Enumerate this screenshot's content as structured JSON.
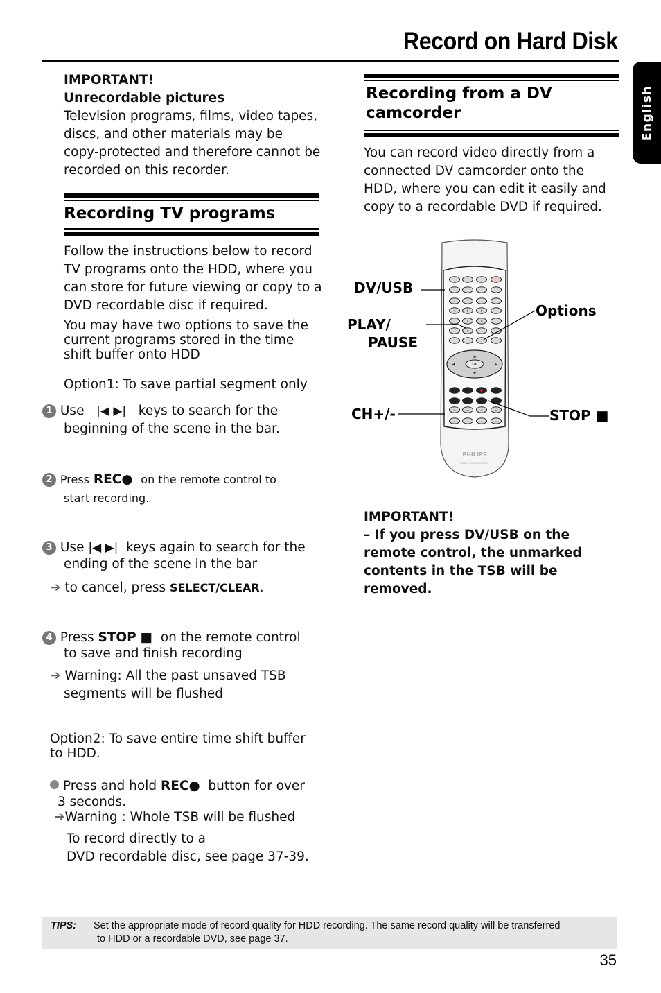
{
  "header": {
    "title": "Record on Hard Disk",
    "language_tab": "English"
  },
  "left_column": {
    "important": {
      "label": "IMPORTANT!",
      "subtitle": "Unrecordable pictures",
      "lines": [
        "Television programs, films, video tapes,",
        "discs, and other materials may be",
        "copy-protected and therefore cannot be",
        "recorded on this recorder."
      ]
    },
    "section_title": "Recording TV programs",
    "intro_lines": [
      "Follow the instructions below to record",
      "TV programs onto the HDD, where you",
      "can store for future viewing or copy to a",
      "DVD recordable disc if required."
    ],
    "options_lines": [
      "You may have two options to save the",
      "current programs stored in the time",
      "shift buffer onto HDD"
    ],
    "option1_heading": "Option1: To save partial segment only",
    "steps": [
      {
        "number": "1",
        "prefix": "Use",
        "icons": "|◀  ▶|",
        "suffix": "keys to search for the",
        "line2": "beginning of the scene in the bar."
      },
      {
        "number": "2",
        "prefix": "Press",
        "bold": "REC",
        "icon": "●",
        "suffix": "on the remote control to",
        "line2": "start recording."
      },
      {
        "number": "3",
        "prefix": "Use",
        "icons": "|◀  ▶|",
        "suffix": "keys again to search for the",
        "line2": "ending of the scene in the bar",
        "note_prefix": "to cancel, press",
        "note_bold": "SELECT/CLEAR",
        "note_suffix": "."
      },
      {
        "number": "4",
        "prefix": "Press",
        "bold": "STOP",
        "icon": "■",
        "suffix": "on the remote control",
        "line2": "to save and finish recording",
        "note_line1": "Warning: All the past unsaved TSB",
        "note_line2": "segments will be flushed"
      }
    ],
    "option2": {
      "line1": "Option2: To save entire time shift buffer",
      "line2": "to HDD.",
      "bullet_prefix": "Press and hold",
      "bullet_bold": "REC",
      "bullet_icon": "●",
      "bullet_suffix": "button for over",
      "bullet_line2": "3 seconds.",
      "warning": "Warning : Whole TSB will be flushed",
      "ref_line1": "To record directly to a",
      "ref_line2": "DVD recordable disc, see page 37-39."
    }
  },
  "right_column": {
    "section_title_line1": "Recording from a DV",
    "section_title_line2": "camcorder",
    "intro_lines": [
      "You can record video directly from a",
      "connected DV camcorder onto the",
      "HDD, where you can edit it easily and",
      "copy to a recordable DVD if required."
    ],
    "remote": {
      "brand": "PHILIPS",
      "model": "HDD & DVD RECORDER",
      "ok_label": "OK",
      "number_keys": [
        "1",
        "2",
        "3",
        "4",
        "5",
        "6",
        "7",
        "8",
        "9",
        "0"
      ],
      "callouts": {
        "dv_usb": "DV/USB",
        "play_pause_1": "PLAY/",
        "play_pause_2": "PAUSE",
        "ch": "CH+/-",
        "options": "Options",
        "stop": "STOP ■"
      }
    },
    "important": {
      "label": "IMPORTANT!",
      "lines": [
        "–  If you press DV/USB on the",
        "remote control, the unmarked",
        "contents in the TSB will be",
        "removed."
      ]
    }
  },
  "footer": {
    "tips_label": "TIPS:",
    "tips_line1": "Set the appropriate mode of record quality for HDD recording. The same record quality will be transferred",
    "tips_line2": "to HDD or a recordable DVD, see page 37.",
    "page_number": "35"
  }
}
